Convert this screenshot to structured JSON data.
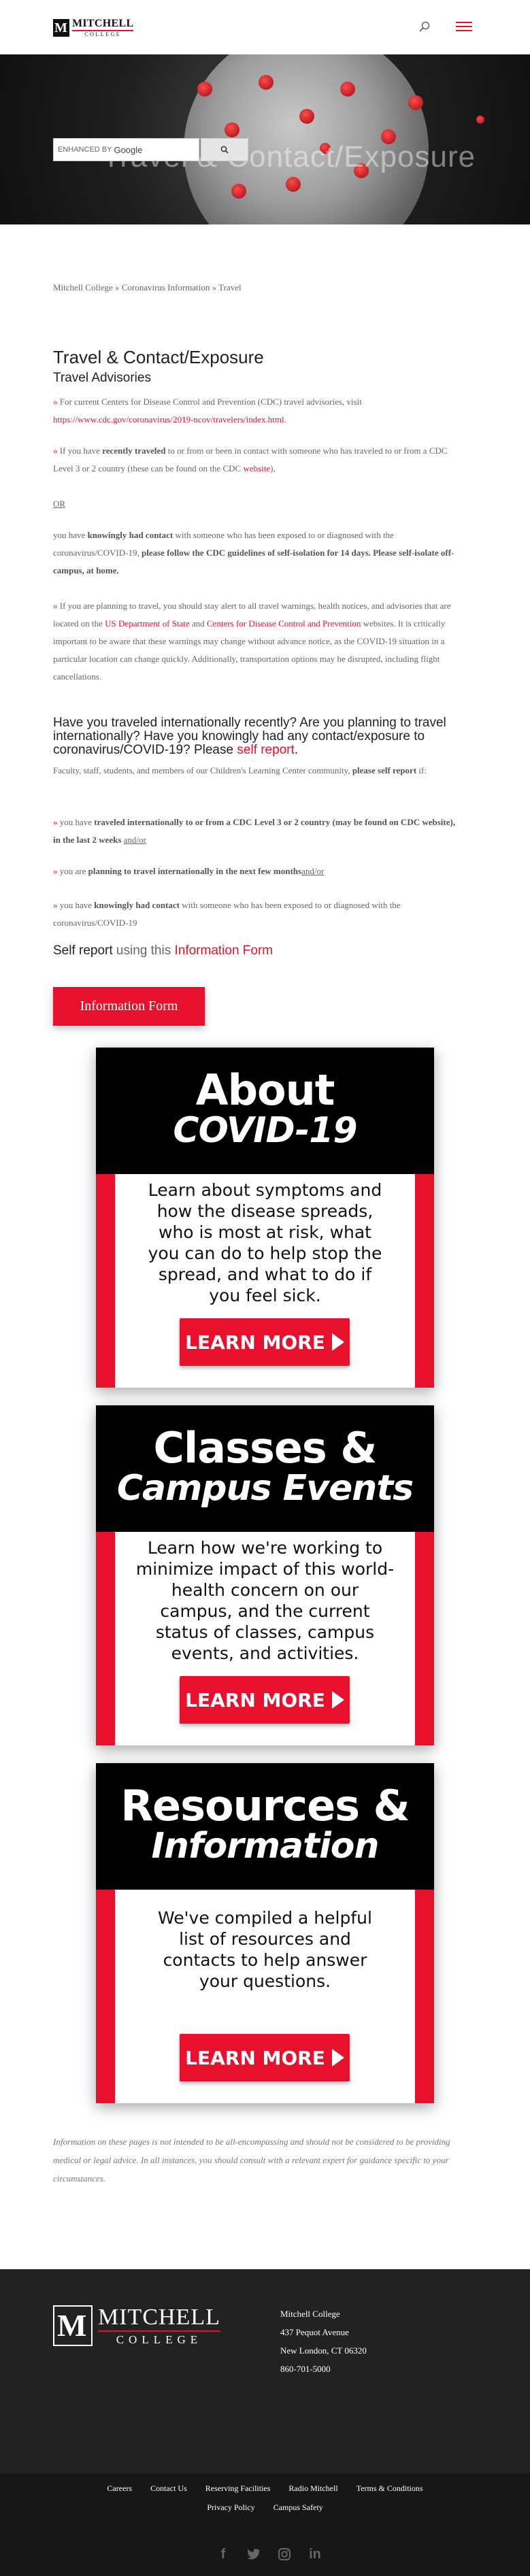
{
  "header": {
    "logo_top": "MITCHELL",
    "logo_bottom": "COLLEGE"
  },
  "hero": {
    "title": "Travel & Contact/Exposure"
  },
  "breadcrumb": {
    "items": [
      "Mitchell College",
      "Coronavirus Information",
      "Travel"
    ],
    "separator": " » "
  },
  "main": {
    "title": "Travel & Contact/Exposure",
    "subtitle": "Travel Advisories",
    "p1_prefix": "For current Centers for Disease Control and Prevention (CDC) travel advisories, visit ",
    "p1_link": "https://www.cdc.gov/coronavirus/2019-ncov/travelers/index.html",
    "p1_suffix": ".",
    "p2_a": "If you have ",
    "p2_bold": "recently traveled",
    "p2_b": " to or from or been in contact with someone who has traveled to or from a CDC Level 3 or 2 country (these can be found on the CDC ",
    "p2_link": "website",
    "p2_c": "),",
    "or_label": "OR",
    "p3_a": "you have ",
    "p3_bold": "knowingly had contact",
    "p3_b": " with someone who has been exposed to or diagnosed with the coronavirus/COVID-19, ",
    "p3_bold2": "please follow the CDC guidelines of self-isolation for 14 days. Please self-isolate off-campus, at home.",
    "p4_a": "If you are planning to travel, you should stay alert to all travel warnings, health notices, and advisories that are located on the ",
    "p4_link1": "US Department of State",
    "p4_and": " and ",
    "p4_link2": "Centers for Disease Control and Prevention",
    "p4_b": " websites. It is critically important to be aware that these warnings may change without advance notice, as the COVID-19 situation in a particular location can change quickly. Additionally, transportation options may be disrupted, including flight cancellations.",
    "question_a": "Have you traveled internationally recently? Are you planning to travel internationally? Have you knowingly had any contact/exposure to coronavirus/COVID-19? Please ",
    "question_link": "self report",
    "question_b": ".",
    "p5_a": "Faculty, staff, students, and members of our Children's Learning Center community, ",
    "p5_bold": "please self report",
    "p5_b": " if:",
    "p6_a": "you have ",
    "p6_bold": "traveled internationally to or from a CDC Level 3 or 2 country (may be found on CDC ",
    "p6_link": "website",
    "p6_bold2": "), in the last 2 weeks",
    "p6_andor": "and/or",
    "p7_a": "you are ",
    "p7_bold": "planning to travel internationally in the next few months",
    "p7_andor": "and/or",
    "p8_a": "you have ",
    "p8_bold": "knowingly had contact",
    "p8_b": " with someone who has been exposed to or diagnosed with the coronavirus/COVID-19",
    "self_report_a": "Self report",
    "self_report_b": " using this ",
    "self_report_link": "Information Form",
    "info_button": "Information Form"
  },
  "cards": [
    {
      "title1": "About",
      "title2": "COVID-19",
      "text": "Learn about symptoms and how the disease spreads, who is most at risk, what you can do to help stop the spread, and what to do if you feel sick.",
      "button": "LEARN MORE"
    },
    {
      "title1": "Classes &",
      "title2": "Campus Events",
      "text": "Learn how we're working to minimize impact of this world-health concern on our campus, and the current status of classes, campus events, and activities.",
      "button": "LEARN MORE"
    },
    {
      "title1": "Resources &",
      "title2": "Information",
      "text": "We've compiled a helpful list of resources and contacts to help answer your questions.",
      "button": "LEARN MORE"
    }
  ],
  "disclaimer": "Information on these pages is not intended to be all-encompassing and should not be considered to be providing medical or legal advice. In all instances, you should consult with a relevant expert for guidance specific to your circumstances.",
  "footer": {
    "logo_top": "MITCHELL",
    "logo_bottom": "COLLEGE",
    "address": [
      "Mitchell College",
      "437 Pequot Avenue",
      "New London, CT 06320",
      "860-701-5000"
    ],
    "search_placeholder": "ENHANCED BY",
    "search_brand": "Google",
    "links_row1": [
      "Careers",
      "Contact Us",
      "Reserving Facilities",
      "Radio Mitchell",
      "Terms & Conditions"
    ],
    "links_row2": [
      "Privacy Policy",
      "Campus Safety"
    ],
    "socials": [
      "facebook-icon",
      "twitter-icon",
      "instagram-icon",
      "linkedin-icon"
    ]
  },
  "colors": {
    "accent": "#e8112d",
    "footer_bg": "#222222",
    "footer_bottom_bg": "#171717"
  }
}
